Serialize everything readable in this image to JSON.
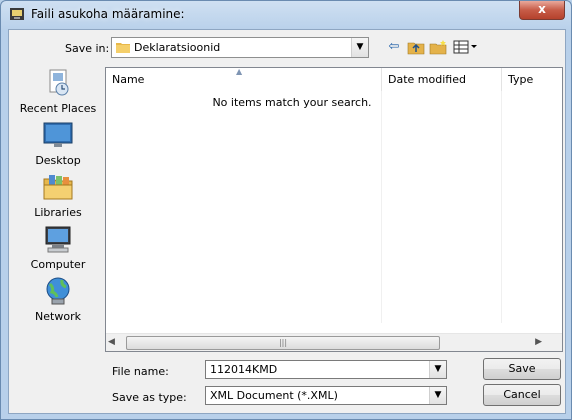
{
  "window": {
    "title": "Faili asukoha määramine:",
    "close_glyph": "x"
  },
  "toolbar": {
    "save_in_label": "Save in:",
    "save_in_value": "Deklaratsioonid",
    "icons": [
      "back-arrow-icon",
      "up-folder-icon",
      "new-folder-icon",
      "view-menu-icon"
    ]
  },
  "places": [
    {
      "label": "Recent Places",
      "icon": "recent-places-icon"
    },
    {
      "label": "Desktop",
      "icon": "desktop-icon"
    },
    {
      "label": "Libraries",
      "icon": "libraries-icon"
    },
    {
      "label": "Computer",
      "icon": "computer-icon"
    },
    {
      "label": "Network",
      "icon": "network-icon"
    }
  ],
  "filelist": {
    "columns": [
      "Name",
      "Date modified",
      "Type"
    ],
    "empty_message": "No items match your search."
  },
  "form": {
    "file_name_label": "File name:",
    "file_name_value": "112014KMD",
    "save_as_type_label": "Save as type:",
    "save_as_type_value": "XML Document (*.XML)"
  },
  "buttons": {
    "save": "Save",
    "cancel": "Cancel"
  }
}
